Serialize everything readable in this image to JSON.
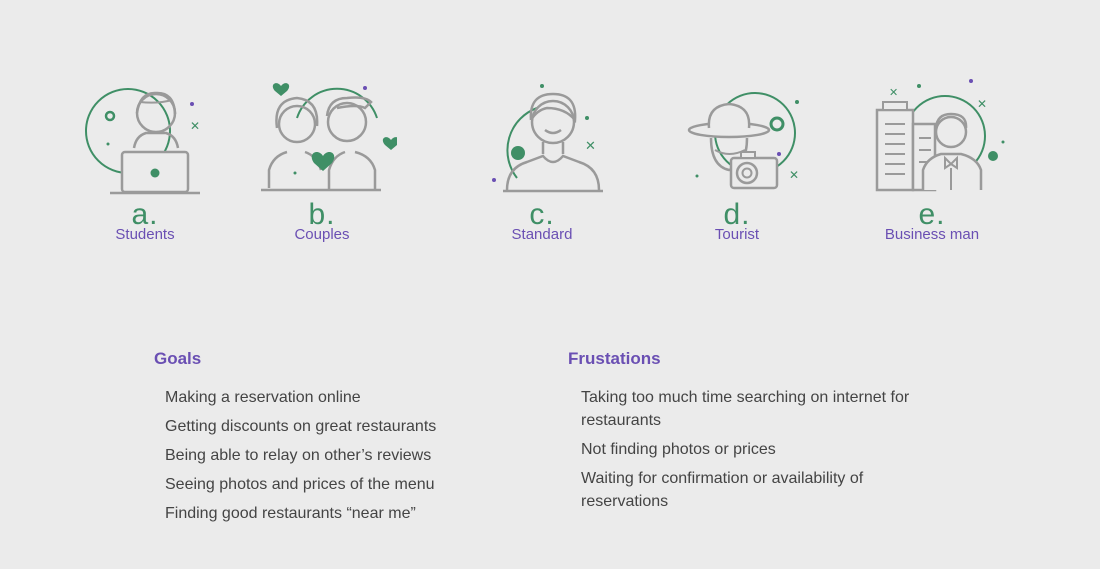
{
  "colors": {
    "accent_purple": "#6a4fb3",
    "accent_green": "#3f8f66",
    "icon_gray": "#9a9a9a",
    "text": "#444444",
    "background": "#ebebeb"
  },
  "personas": [
    {
      "letter": "a.",
      "name": "Students",
      "icon": "student-laptop-icon"
    },
    {
      "letter": "b.",
      "name": "Couples",
      "icon": "couple-hearts-icon"
    },
    {
      "letter": "c.",
      "name": "Standard",
      "icon": "standard-person-icon"
    },
    {
      "letter": "d.",
      "name": "Tourist",
      "icon": "tourist-camera-icon"
    },
    {
      "letter": "e.",
      "name": "Business man",
      "icon": "businessman-building-icon"
    }
  ],
  "goals": {
    "title": "Goals",
    "items": [
      "Making a reservation online",
      "Getting discounts on great restaurants",
      "Being able to relay on other’s reviews",
      "Seeing photos and prices of the menu",
      "Finding good restaurants “near me”"
    ]
  },
  "frustrations": {
    "title": "Frustations",
    "items": [
      "Taking too much time searching on internet for restaurants",
      "Not finding photos or prices",
      "Waiting for confirmation or availability of reservations"
    ]
  }
}
